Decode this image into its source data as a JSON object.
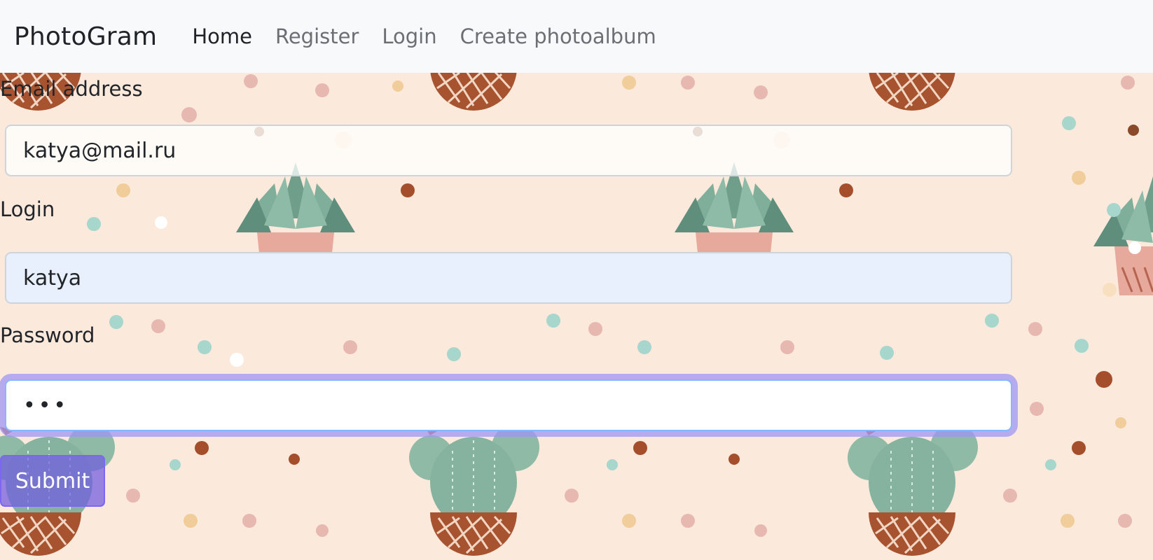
{
  "navbar": {
    "brand": "PhotoGram",
    "links": [
      {
        "label": "Home",
        "active": true
      },
      {
        "label": "Register",
        "active": false
      },
      {
        "label": "Login",
        "active": false
      },
      {
        "label": "Create photoalbum",
        "active": false
      }
    ]
  },
  "form": {
    "email": {
      "label": "Email address",
      "value": "katya@mail.ru"
    },
    "login": {
      "label": "Login",
      "value": "katya"
    },
    "password": {
      "label": "Password",
      "value": "•••",
      "focused": true
    },
    "submit_label": "Submit"
  },
  "theme": {
    "background_color": "#fbe9dc",
    "accent": "#7b68ee",
    "focus_ring": "#a59bf5",
    "autofill_bg": "#e8f0fe"
  },
  "background_pattern": {
    "icons": [
      "pot-icon",
      "succulent-icon",
      "cactus-icon",
      "dot-icon"
    ]
  }
}
